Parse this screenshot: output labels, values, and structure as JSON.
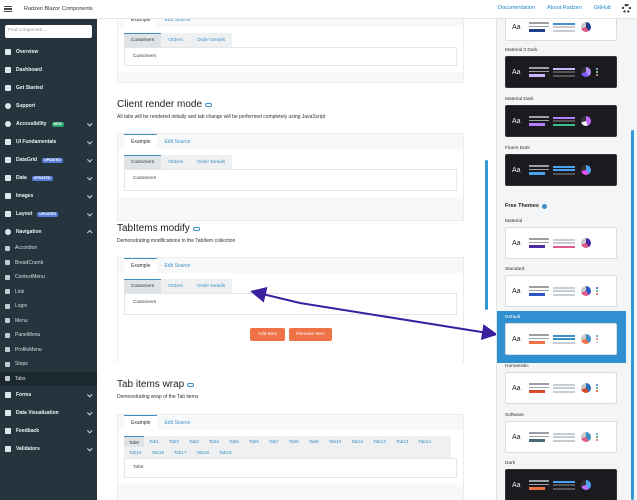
{
  "header": {
    "title": "Radzen Blazor Components",
    "links": [
      "Documentation",
      "About Radzen",
      "GitHub"
    ]
  },
  "sidebar": {
    "search_placeholder": "Find component ...",
    "items": [
      {
        "label": "Overview",
        "icon": "home-icon"
      },
      {
        "label": "Dashboard",
        "icon": "dashboard-icon"
      },
      {
        "label": "Get Started",
        "icon": "rocket-icon"
      },
      {
        "label": "Support",
        "icon": "help-icon"
      },
      {
        "label": "Accessibility",
        "icon": "accessibility-icon",
        "badge": "NEW",
        "chevron": true
      },
      {
        "label": "UI Fundamentals",
        "icon": "palette-icon",
        "chevron": true
      },
      {
        "label": "DataGrid",
        "icon": "grid-icon",
        "badge": "UPDATED",
        "chevron": true
      },
      {
        "label": "Data",
        "icon": "list-icon",
        "badge": "UPDATED",
        "chevron": true
      },
      {
        "label": "Images",
        "icon": "image-icon",
        "chevron": true
      },
      {
        "label": "Layout",
        "icon": "layout-icon",
        "badge": "UPDATED",
        "chevron": true
      },
      {
        "label": "Navigation",
        "icon": "compass-icon",
        "chevron": true,
        "expanded": true
      }
    ],
    "nav_sub": [
      "Accordion",
      "BreadCrumb",
      "ContextMenu",
      "Link",
      "Login",
      "Menu",
      "PanelMenu",
      "ProfileMenu",
      "Steps",
      "Tabs"
    ],
    "after": [
      {
        "label": "Forms",
        "icon": "form-icon"
      },
      {
        "label": "Data Visualization",
        "icon": "chart-icon"
      },
      {
        "label": "Feedback",
        "icon": "feedback-icon"
      },
      {
        "label": "Validators",
        "icon": "check-icon"
      }
    ]
  },
  "main": {
    "top_card": {
      "outer_tabs": [
        "Example",
        "Edit Source"
      ],
      "inner_tabs": [
        "Customers",
        "Orders",
        "Order Details"
      ],
      "content": "Customers"
    },
    "client": {
      "title": "Client render mode",
      "desc": "All tabs will be rendered initially and tab change will be performed completely using JavaScript",
      "outer_tabs": [
        "Example",
        "Edit Source"
      ],
      "inner_tabs": [
        "Customers",
        "Orders",
        "Order Details"
      ],
      "content": "Customers"
    },
    "modify": {
      "title": "TabItems modify",
      "desc": "Demonstrating modifications to the TabItem collection",
      "outer_tabs": [
        "Example",
        "Edit Source"
      ],
      "inner_tabs": [
        "Customers",
        "Orders",
        "Order Details"
      ],
      "content": "Customers",
      "add_label": "Add Item",
      "remove_label": "Remove Item"
    },
    "wrap": {
      "title": "Tab items wrap",
      "desc": "Demonstrating wrap of the Tab items",
      "outer_tabs": [
        "Example",
        "Edit Source"
      ],
      "row1": [
        "Tab0",
        "Tab1",
        "Tab2",
        "Tab3",
        "Tab4",
        "Tab5",
        "Tab6",
        "Tab7",
        "Tab8",
        "Tab9",
        "Tab10",
        "Tab11",
        "Tab12"
      ],
      "row2": [
        "Tab13",
        "Tab14",
        "Tab15",
        "Tab16",
        "Tab17",
        "Tab18",
        "Tab19"
      ],
      "content": "Tab0"
    }
  },
  "themes": {
    "premium_labels": [
      "Material 3 Dark",
      "Material Dark",
      "Fluent Dark"
    ],
    "free_heading": "Free Themes",
    "free_labels": [
      "Material",
      "Standard",
      "Default",
      "Humanistic",
      "Software",
      "Dark"
    ],
    "colors": {
      "accent": "#2f8fd0",
      "arrow": "#3b1f9e",
      "button": "#ef7246"
    }
  }
}
